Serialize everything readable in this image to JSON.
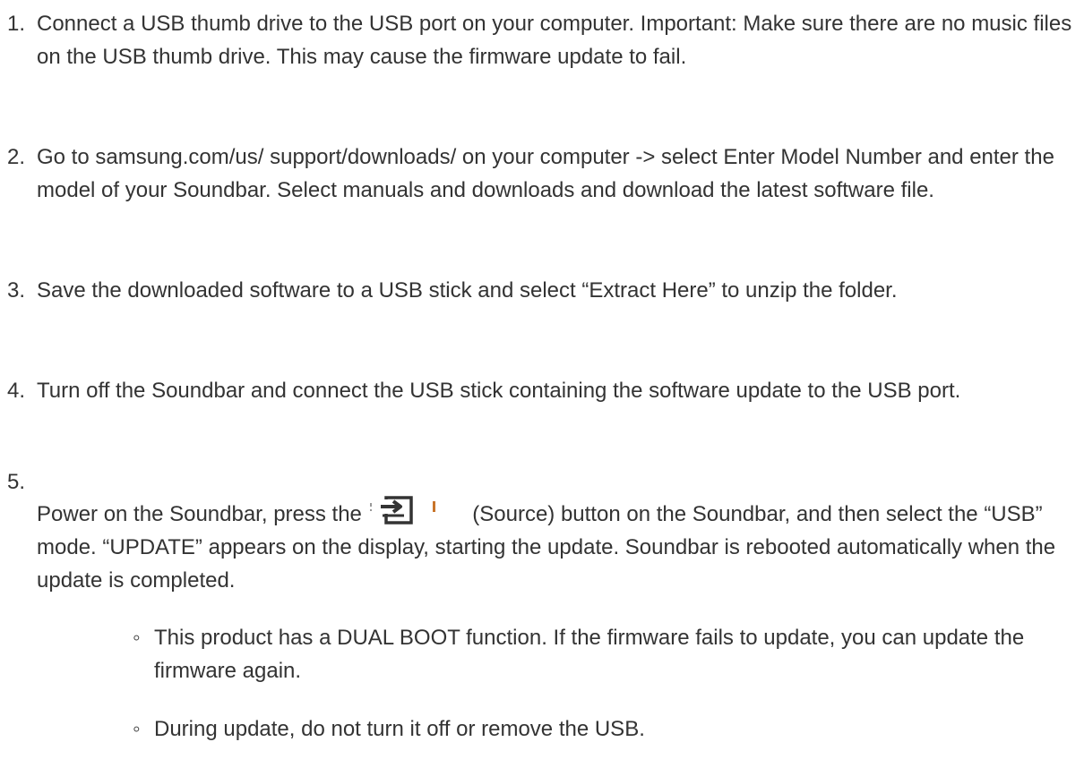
{
  "steps": [
    {
      "num": "1.",
      "text": "Connect a USB thumb drive to the USB port on your computer. Important: Make sure there are no music files on the USB thumb drive. This may cause the firmware update to fail."
    },
    {
      "num": "2.",
      "text": "Go to samsung.com/us/ support/downloads/ on your computer -> select Enter Model Number and enter the model of your Soundbar. Select manuals and downloads and download the latest software file."
    },
    {
      "num": "3.",
      "text": "Save the downloaded software to a USB stick and select “Extract Here” to unzip the folder."
    },
    {
      "num": "4.",
      "text": "Turn off the Soundbar and connect the USB stick containing the software update to the USB port."
    },
    {
      "num": "5.",
      "before_icon": "Power on the Soundbar, press the",
      "after_icon": "(Source) button on the Soundbar, and then select the “USB” mode. “UPDATE” appears on the display, starting the update. Soundbar is rebooted automatically when the update is completed.",
      "icon": "source-input-icon"
    }
  ],
  "sub_bullets": [
    {
      "bullet": "◦",
      "text": "This product has a DUAL BOOT function. If the firmware fails to update, you can update the firmware again."
    },
    {
      "bullet": "◦",
      "text": "During update, do not turn it off or remove the USB."
    }
  ],
  "colors": {
    "text": "#333333",
    "icon_accent": "#c8742a"
  }
}
